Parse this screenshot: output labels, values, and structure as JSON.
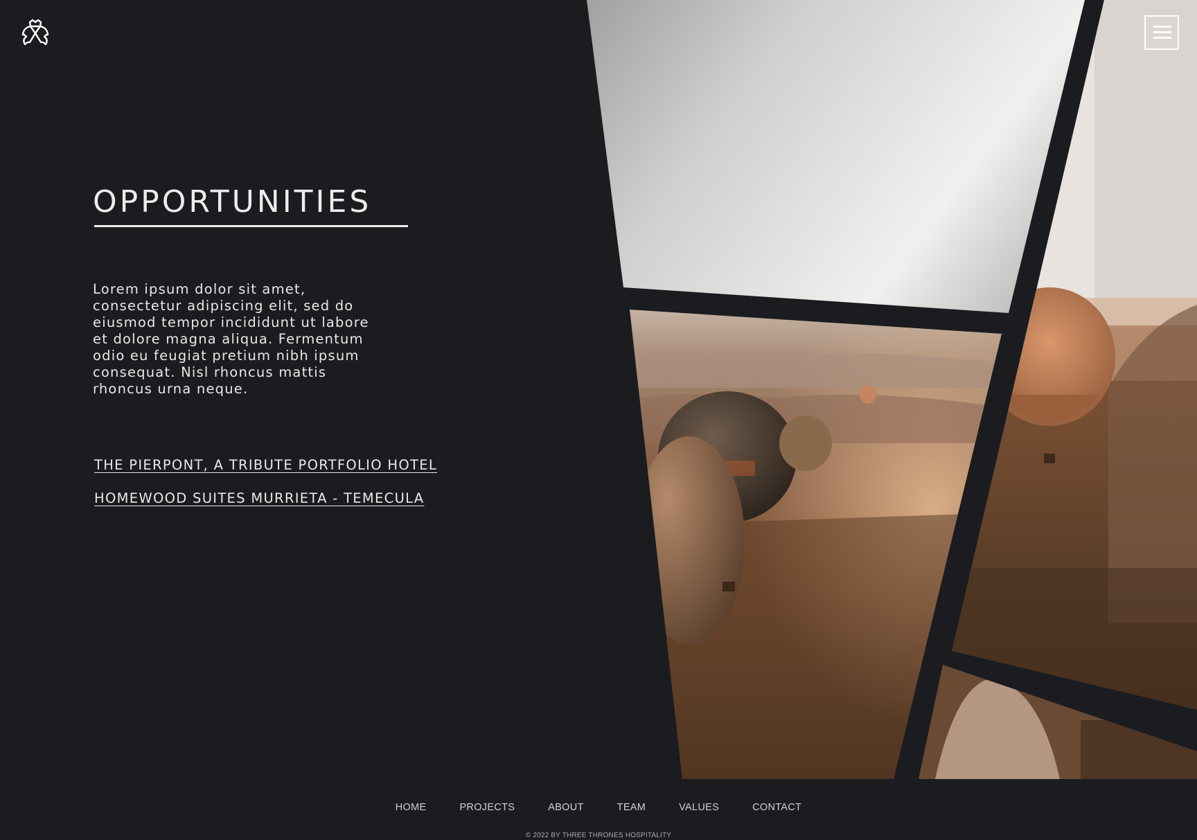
{
  "brand": {
    "logo_icon": "crest-icon"
  },
  "header": {
    "menu_icon": "hamburger-menu-icon"
  },
  "main": {
    "title": "OPPORTUNITIES",
    "body": "Lorem ipsum dolor sit amet, consectetur adipiscing elit, sed do eiusmod tempor incididunt ut labore et dolore magna aliqua. Fermentum odio eu feugiat pretium nibh ipsum consequat. Nisl rhoncus mattis rhoncus urna neque.",
    "links": [
      "THE PIERPONT, A TRIBUTE PORTFOLIO HOTEL",
      "HOMEWOOD SUITES MURRIETA - TEMECULA"
    ]
  },
  "footer": {
    "nav": [
      "HOME",
      "PROJECTS",
      "ABOUT",
      "TEAM",
      "VALUES",
      "CONTACT"
    ],
    "copyright": "© 2022 BY THREE THRONES HOSPITALITY"
  },
  "colors": {
    "background": "#1a1c20",
    "text": "#e8e8e8",
    "accent": "#c98a5a"
  }
}
